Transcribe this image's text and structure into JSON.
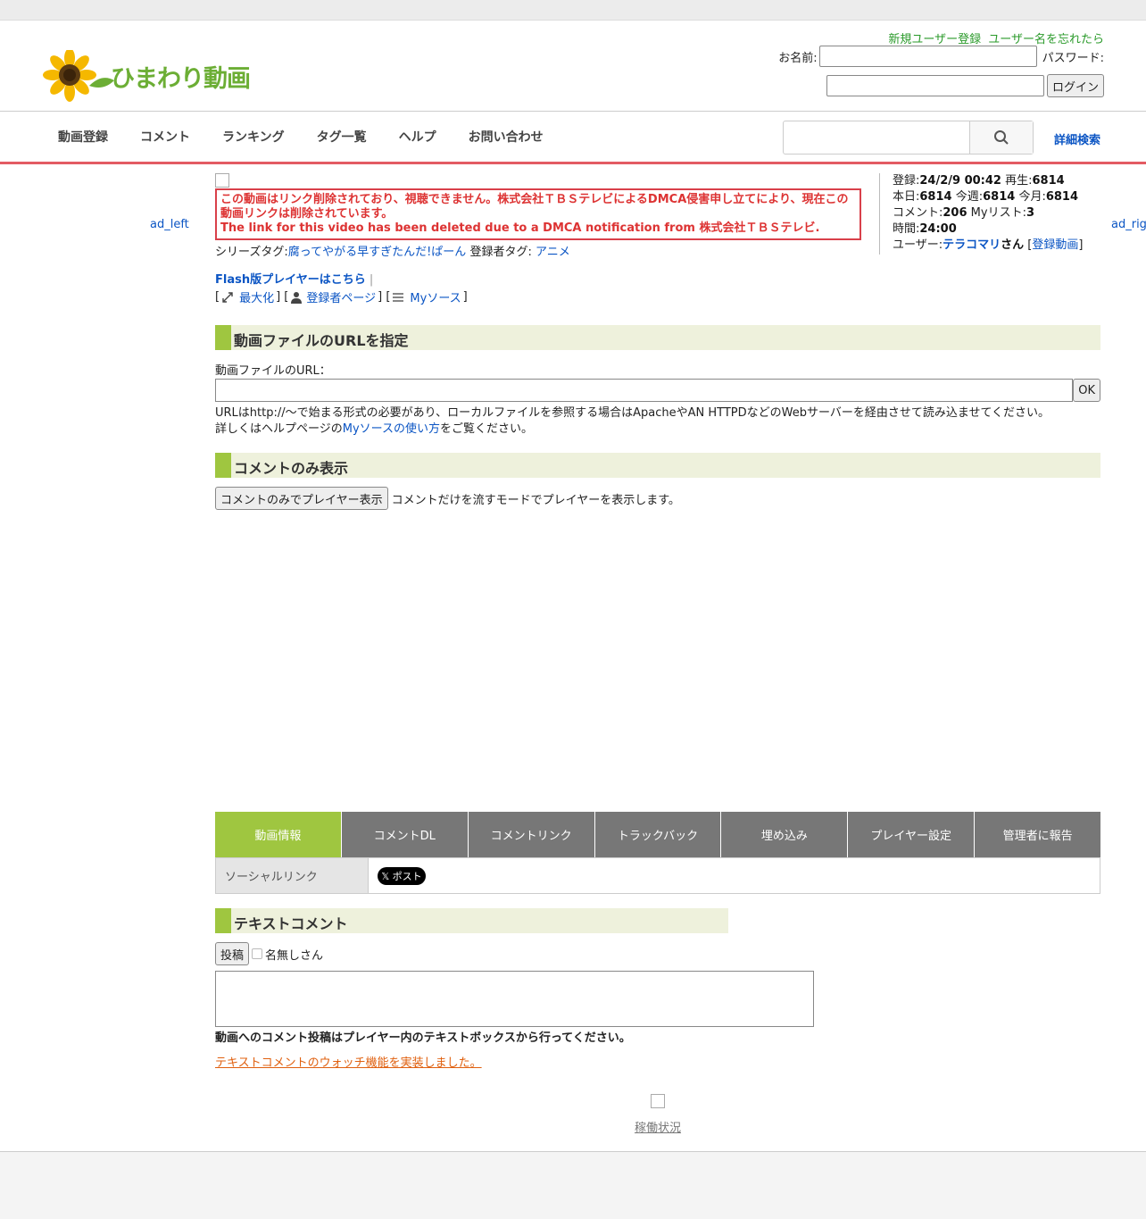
{
  "header": {
    "logo_alt": "ひまわり動画",
    "register_link": "新規ユーザー登録",
    "forgot_link": "ユーザー名を忘れたら",
    "name_label": "お名前:",
    "password_label": "パスワード:",
    "login_button": "ログイン"
  },
  "nav": {
    "items": [
      "動画登録",
      "コメント",
      "ランキング",
      "タグ一覧",
      "ヘルプ",
      "お問い合わせ"
    ],
    "advanced_search": "詳細検索"
  },
  "ads": {
    "left": "ad_left",
    "right": "ad_right"
  },
  "notice": {
    "ja": "この動画はリンク削除されており、視聴できません。株式会社ＴＢＳテレビによるDMCA侵害申し立てにより、現在この動画リンクは削除されています。",
    "en": "The link for this video has been deleted due to a DMCA notification from 株式会社ＴＢＳテレビ."
  },
  "tags": {
    "series_label": "シリーズタグ:",
    "series_value": "腐ってやがる早すぎたんだ!ぱーん",
    "user_label": "登録者タグ:",
    "user_value": "アニメ"
  },
  "links": {
    "flash_player": "Flash版プレイヤーはこちら",
    "maximize": "最大化",
    "uploader_page": "登録者ページ",
    "mysource": "Myソース"
  },
  "info": {
    "registered_label": "登録:",
    "registered": "24/2/9 00:42",
    "plays_label": "再生:",
    "plays": "6814",
    "today_label": "本日:",
    "today": "6814",
    "week_label": "今週:",
    "week": "6814",
    "month_label": "今月:",
    "month": "6814",
    "comments_label": "コメント:",
    "comments": "206",
    "mylist_label": "Myリスト:",
    "mylist": "3",
    "duration_label": "時間:",
    "duration": "24:00",
    "user_label": "ユーザー:",
    "user": "テラコマリ",
    "user_suffix": "さん",
    "user_videos": "登録動画"
  },
  "url_section": {
    "heading": "動画ファイルのURLを指定",
    "field_label": "動画ファイルのURL：",
    "ok_button": "OK",
    "help1": "URLはhttp://〜で始まる形式の必要があり、ローカルファイルを参照する場合はApacheやAN HTTPDなどのWebサーバーを経由させて読み込ませてください。",
    "help2_pre": "詳しくはヘルプページの",
    "help2_link": "Myソースの使い方",
    "help2_post": "をご覧ください。"
  },
  "comment_only": {
    "heading": "コメントのみ表示",
    "button": "コメントのみでプレイヤー表示",
    "desc": "コメントだけを流すモードでプレイヤーを表示します。"
  },
  "tabs": [
    "動画情報",
    "コメントDL",
    "コメントリンク",
    "トラックバック",
    "埋め込み",
    "プレイヤー設定",
    "管理者に報告"
  ],
  "social": {
    "label": "ソーシャルリンク",
    "x_button": "𝕏 ポスト"
  },
  "text_comment": {
    "heading": "テキストコメント",
    "post_button": "投稿",
    "anon_label": "名無しさん",
    "note": "動画へのコメント投稿はプレイヤー内のテキストボックスから行ってください。",
    "watch_link": "テキストコメントのウォッチ機能を実装しました。"
  },
  "footer": {
    "status_link": "稼働状況"
  },
  "colors": {
    "accent_green": "#9fc640",
    "nav_red": "#e35b63",
    "notice_red": "#d9404a",
    "link_blue": "#0b55c4"
  }
}
